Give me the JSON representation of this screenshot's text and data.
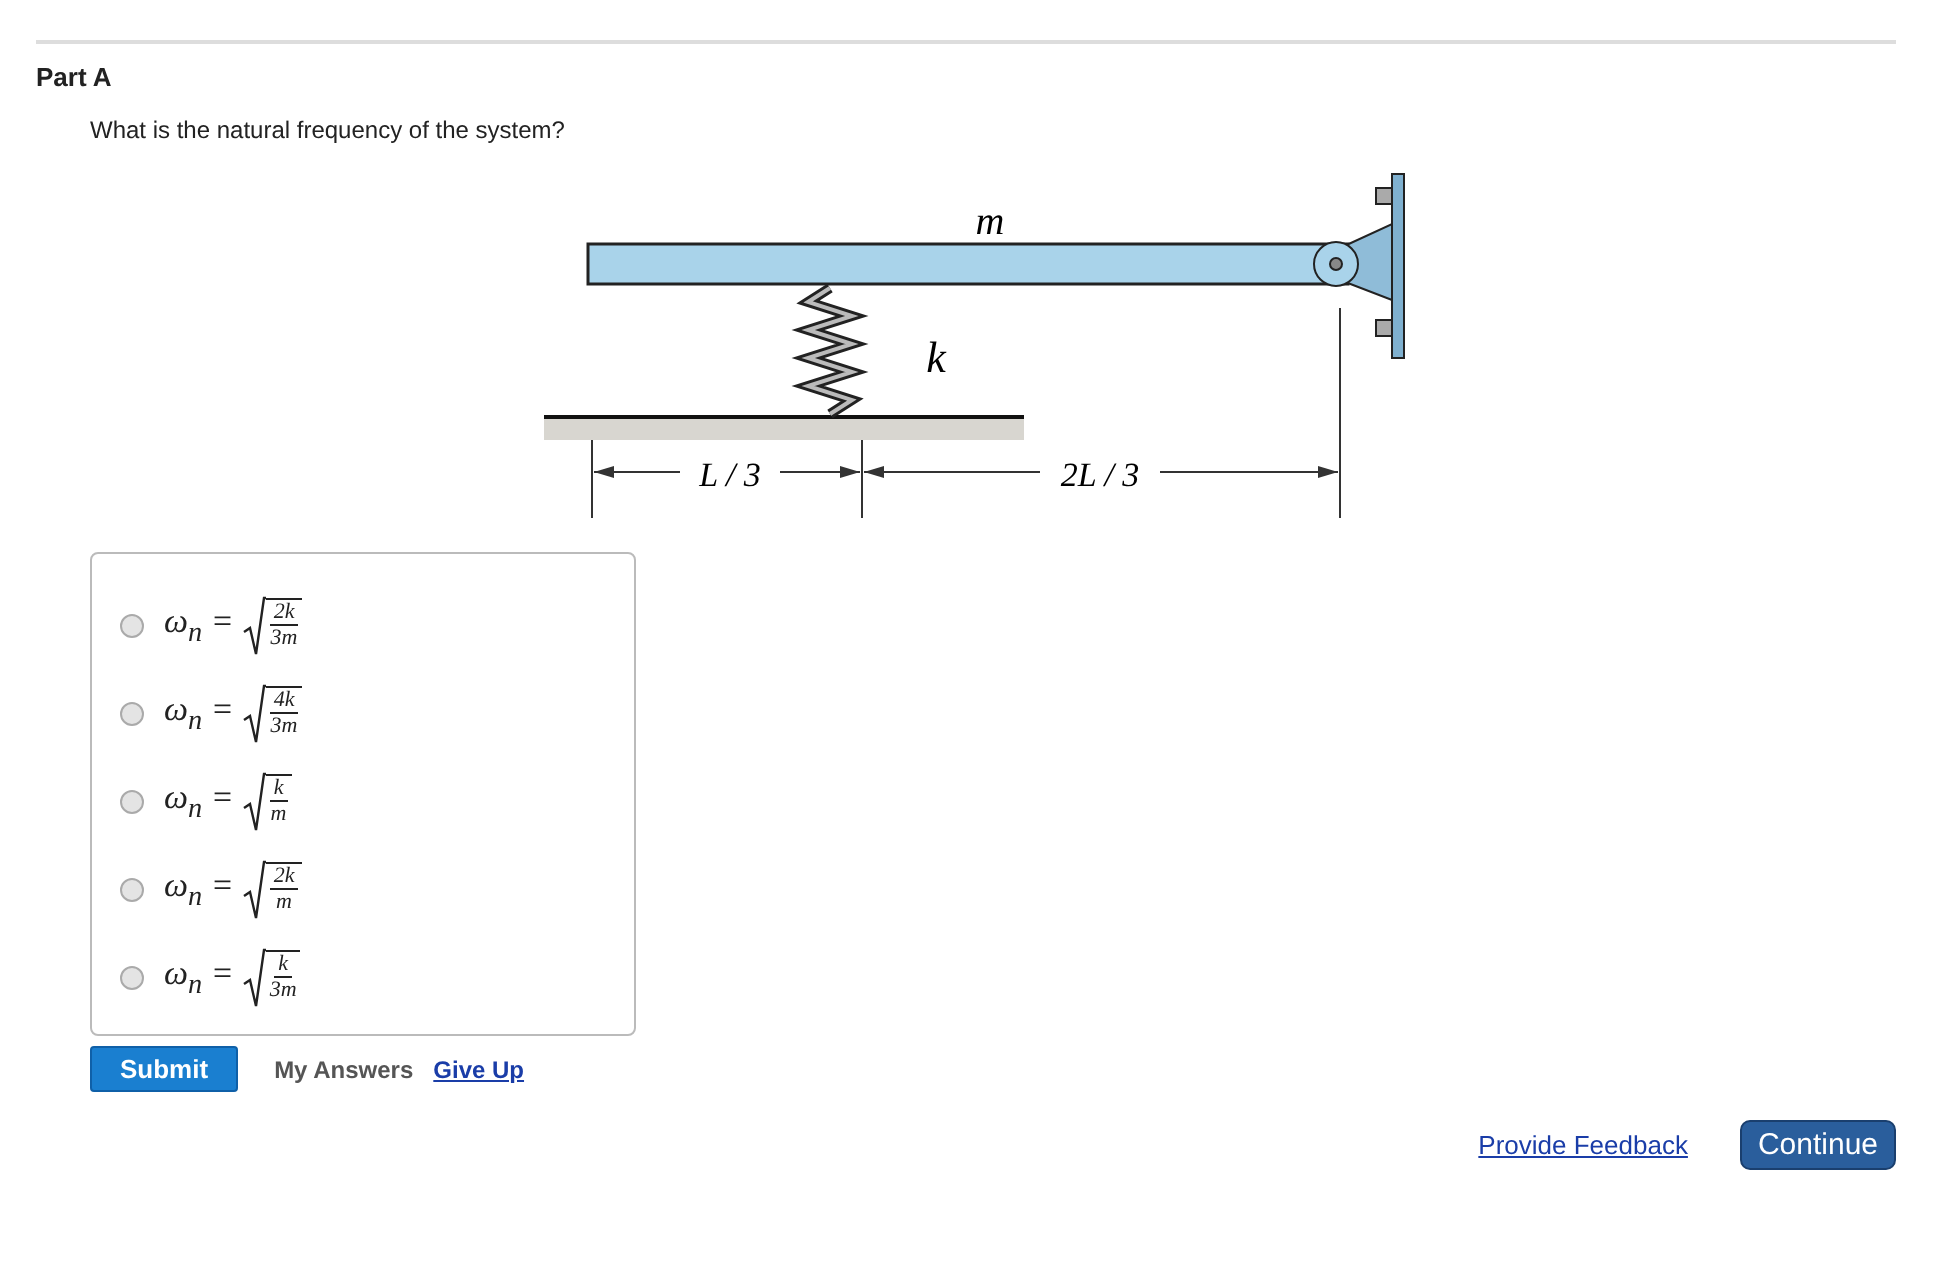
{
  "part": {
    "title": "Part A",
    "question": "What is the natural frequency of the system?"
  },
  "figure": {
    "labels": {
      "mass": "m",
      "stiffness": "k",
      "left_span": "L / 3",
      "right_span": "2L / 3"
    }
  },
  "options": [
    {
      "lhs": "ω$_{n}$ =",
      "numerator": "2k",
      "denominator": "3m",
      "selected": false
    },
    {
      "lhs": "ω$_{n}$ =",
      "numerator": "4k",
      "denominator": "3m",
      "selected": false
    },
    {
      "lhs": "ω$_{n}$ =",
      "numerator": "k",
      "denominator": "m",
      "selected": false
    },
    {
      "lhs": "ω$_{n}$ =",
      "numerator": "2k",
      "denominator": "m",
      "selected": false
    },
    {
      "lhs": "ω$_{n}$ =",
      "numerator": "k",
      "denominator": "3m",
      "selected": false
    }
  ],
  "actions": {
    "submit": "Submit",
    "my_answers": "My Answers",
    "give_up": "Give Up"
  },
  "footer": {
    "feedback": "Provide Feedback",
    "continue": "Continue"
  }
}
